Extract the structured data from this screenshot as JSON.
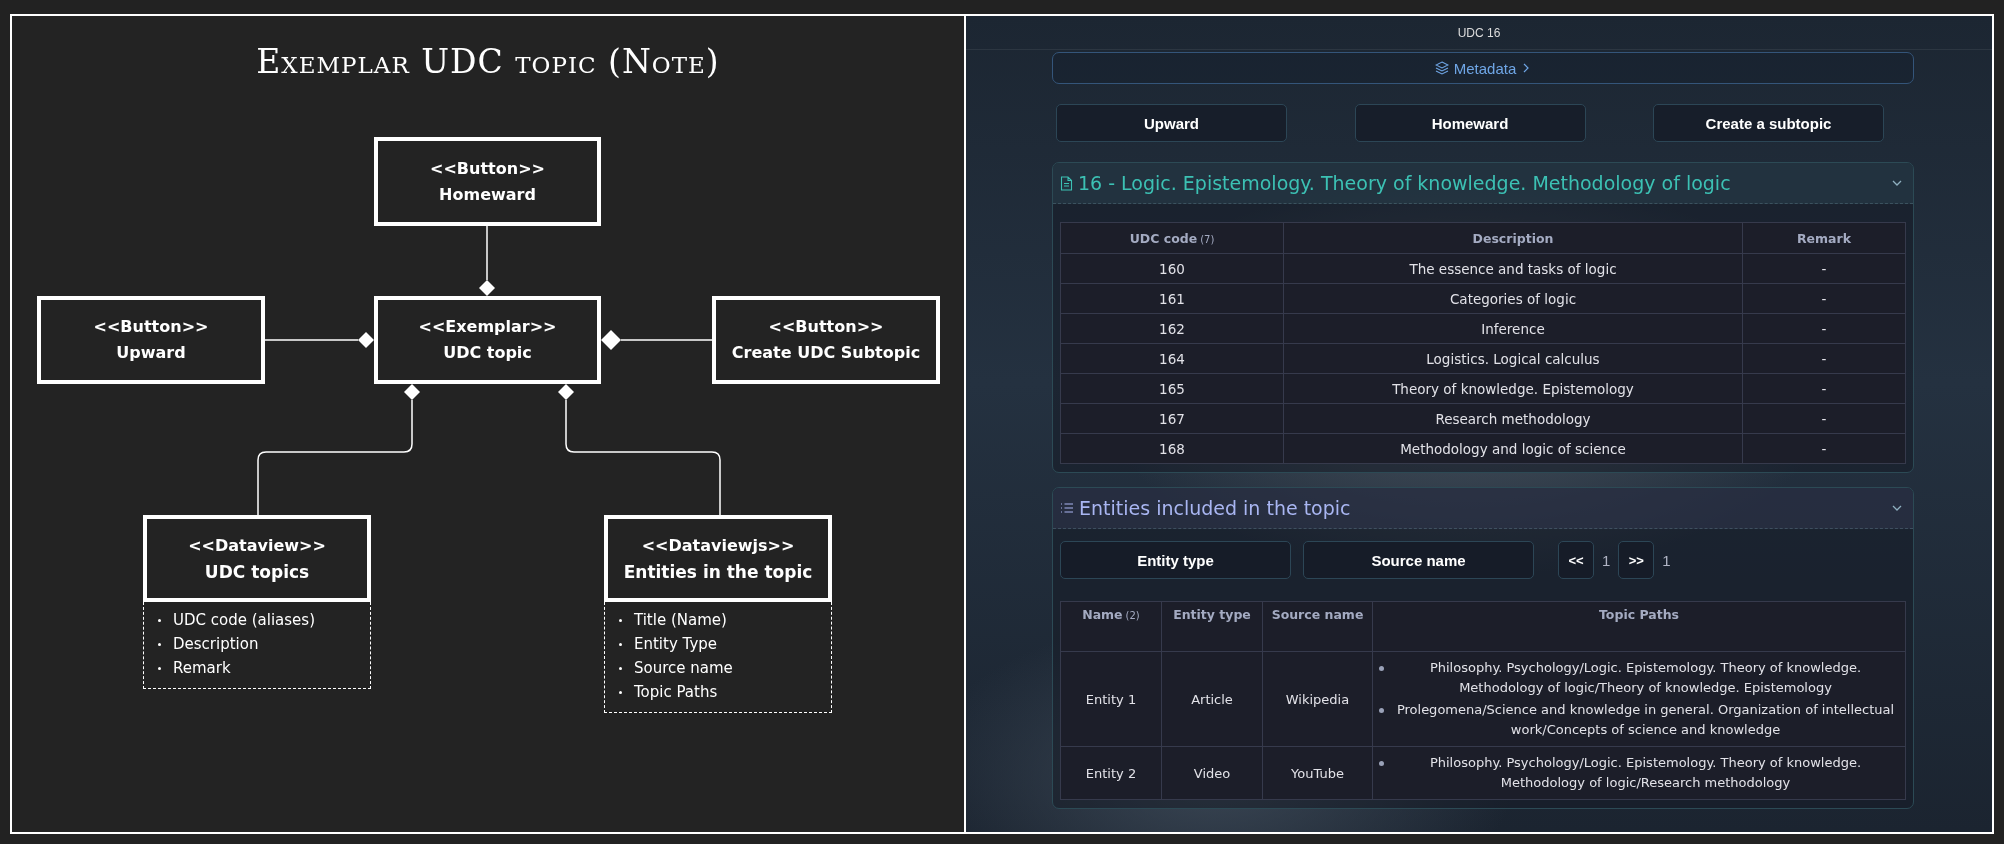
{
  "diagram": {
    "title": "Exemplar UDC topic (Note)",
    "nodes": [
      {
        "kind": "button",
        "stereotype": "<<Button>>",
        "name": "Homeward"
      },
      {
        "kind": "button",
        "stereotype": "<<Button>>",
        "name": "Upward"
      },
      {
        "kind": "exemplar",
        "stereotype": "<<Exemplar>>",
        "name": "UDC topic"
      },
      {
        "kind": "button",
        "stereotype": "<<Button>>",
        "name": "Create UDC Subtopic"
      },
      {
        "kind": "dataview",
        "stereotype": "<<Dataview>>",
        "name": "UDC topics",
        "fields": [
          "UDC code (aliases)",
          "Description",
          "Remark"
        ]
      },
      {
        "kind": "dataview",
        "stereotype": "<<Dataviewjs>>",
        "name": "Entities in the topic",
        "fields": [
          "Title (Name)",
          "Entity Type",
          "Source name",
          "Topic Paths"
        ]
      }
    ]
  },
  "note": {
    "title": "UDC 16",
    "metadata_label": "Metadata",
    "buttons": [
      "Upward",
      "Homeward",
      "Create a subtopic"
    ],
    "topic_section": {
      "title": "16 - Logic. Epistemology. Theory of knowledge. Methodology of logic",
      "expanded": true,
      "table": {
        "columns": [
          {
            "label": "UDC code",
            "count": "(7)"
          },
          {
            "label": "Description"
          },
          {
            "label": "Remark"
          }
        ],
        "rows": [
          [
            "160",
            "The essence and tasks of logic",
            "-"
          ],
          [
            "161",
            "Categories of logic",
            "-"
          ],
          [
            "162",
            "Inference",
            "-"
          ],
          [
            "164",
            "Logistics. Logical calculus",
            "-"
          ],
          [
            "165",
            "Theory of knowledge. Epistemology",
            "-"
          ],
          [
            "167",
            "Research methodology",
            "-"
          ],
          [
            "168",
            "Methodology and logic of science",
            "-"
          ]
        ]
      }
    },
    "entities_section": {
      "title": "Entities included in the topic",
      "expanded": true,
      "filters": [
        "Entity type",
        "Source name"
      ],
      "pager": {
        "prev": "<<",
        "page": "1",
        "next": ">>",
        "total": "1"
      },
      "table": {
        "columns": [
          {
            "label": "Name",
            "count": "(2)"
          },
          {
            "label": "Entity type"
          },
          {
            "label": "Source name"
          },
          {
            "label": "Topic Paths"
          }
        ],
        "rows": [
          {
            "name": "Entity 1",
            "type": "Article",
            "source": "Wikipedia",
            "paths": [
              "Philosophy. Psychology/Logic. Epistemology. Theory of knowledge. Methodology of logic/Theory of knowledge. Epistemology",
              "Prolegomena/Science and knowledge in general. Organization of intellectual work/Concepts of science and knowledge"
            ]
          },
          {
            "name": "Entity 2",
            "type": "Video",
            "source": "YouTube",
            "paths": [
              "Philosophy. Psychology/Logic. Epistemology. Theory of knowledge. Methodology of logic/Research methodology"
            ]
          }
        ]
      }
    }
  }
}
